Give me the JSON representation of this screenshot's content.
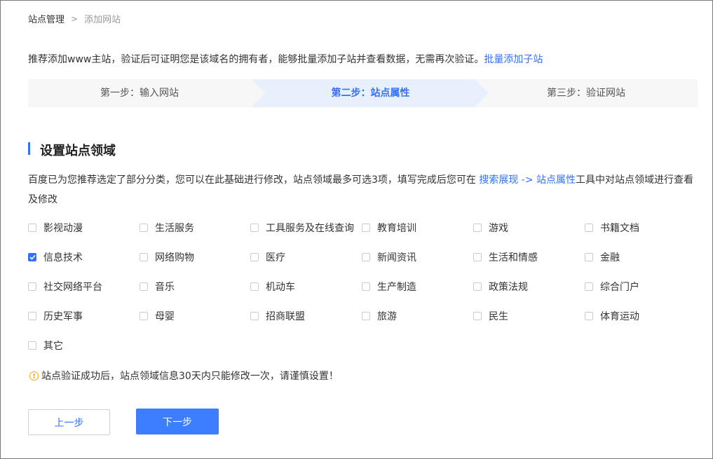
{
  "breadcrumb": {
    "root": "站点管理",
    "separator": ">",
    "current": "添加网站"
  },
  "intro": {
    "text": "推荐添加www主站，验证后可证明您是该域名的拥有者，能够批量添加子站并查看数据，无需再次验证。",
    "link": "批量添加子站"
  },
  "steps": [
    {
      "label": "第一步：输入网站"
    },
    {
      "label": "第二步：站点属性"
    },
    {
      "label": "第三步：验证网站"
    }
  ],
  "section": {
    "title": "设置站点领域",
    "desc_before": "百度已为您推荐选定了部分分类，您可以在此基础进行修改，站点领域最多可选3项，填写完成后您可在 ",
    "desc_link": "搜索展现 -> 站点属性",
    "desc_after": "工具中对站点领域进行查看及修改"
  },
  "options": [
    {
      "label": "影视动漫",
      "checked": false
    },
    {
      "label": "生活服务",
      "checked": false
    },
    {
      "label": "工具服务及在线查询",
      "checked": false
    },
    {
      "label": "教育培训",
      "checked": false
    },
    {
      "label": "游戏",
      "checked": false
    },
    {
      "label": "书籍文档",
      "checked": false
    },
    {
      "label": "信息技术",
      "checked": true
    },
    {
      "label": "网络购物",
      "checked": false
    },
    {
      "label": "医疗",
      "checked": false
    },
    {
      "label": "新闻资讯",
      "checked": false
    },
    {
      "label": "生活和情感",
      "checked": false
    },
    {
      "label": "金融",
      "checked": false
    },
    {
      "label": "社交网络平台",
      "checked": false
    },
    {
      "label": "音乐",
      "checked": false
    },
    {
      "label": "机动车",
      "checked": false
    },
    {
      "label": "生产制造",
      "checked": false
    },
    {
      "label": "政策法规",
      "checked": false
    },
    {
      "label": "综合门户",
      "checked": false
    },
    {
      "label": "历史军事",
      "checked": false
    },
    {
      "label": "母婴",
      "checked": false
    },
    {
      "label": "招商联盟",
      "checked": false
    },
    {
      "label": "旅游",
      "checked": false
    },
    {
      "label": "民生",
      "checked": false
    },
    {
      "label": "体育运动",
      "checked": false
    },
    {
      "label": "其它",
      "checked": false
    }
  ],
  "warning": {
    "icon": "warning-icon",
    "text": "站点验证成功后，站点领域信息30天内只能修改一次，请谨慎设置！"
  },
  "buttons": {
    "prev": "上一步",
    "next": "下一步"
  },
  "colors": {
    "accent": "#3370ff",
    "primary_button": "#3d7dff",
    "active_step_bg": "#e8f0fd",
    "warning": "#f5a623"
  }
}
